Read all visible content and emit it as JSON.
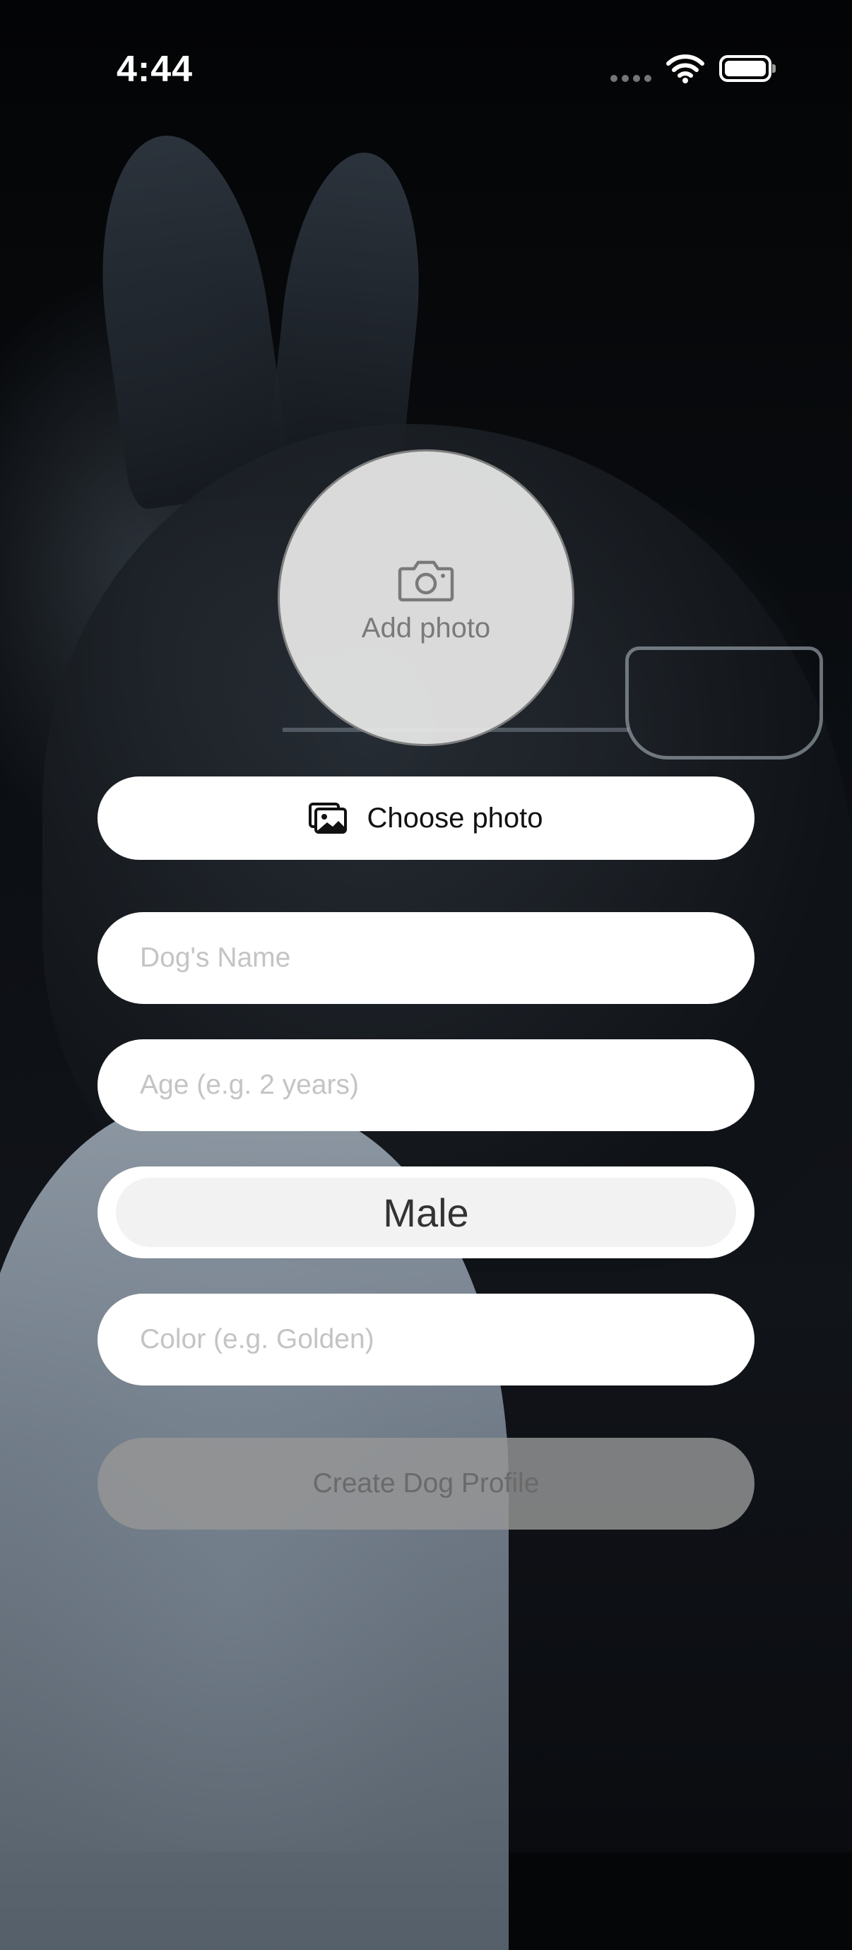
{
  "status_bar": {
    "time": "4:44",
    "wifi_icon": "wifi-icon",
    "battery_icon": "battery-full-icon"
  },
  "photo": {
    "icon": "camera-icon",
    "label": "Add photo"
  },
  "choose_photo": {
    "icon": "photo-library-icon",
    "label": "Choose photo"
  },
  "form": {
    "name": {
      "value": "",
      "placeholder": "Dog's Name"
    },
    "age": {
      "value": "",
      "placeholder": "Age (e.g. 2 years)"
    },
    "gender": {
      "selected": "Male"
    },
    "color": {
      "value": "",
      "placeholder": "Color (e.g. Golden)"
    }
  },
  "create_button": {
    "label": "Create Dog Profile"
  },
  "colors": {
    "field_background": "#ffffff",
    "placeholder": "#c4c4c6",
    "create_button_disabled": "#969696"
  }
}
